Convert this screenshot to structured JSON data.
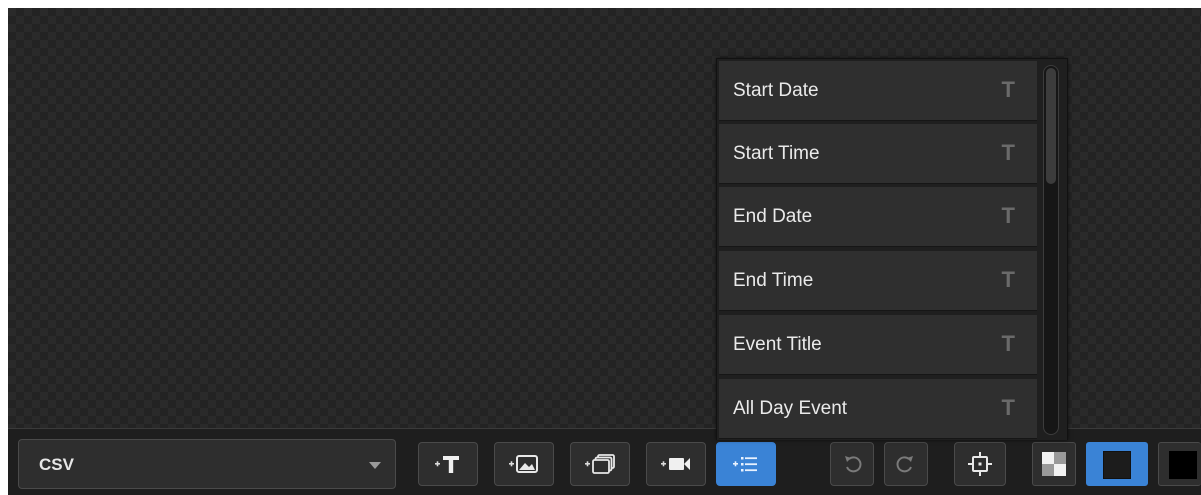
{
  "source": {
    "selected": "CSV"
  },
  "toolbar": {
    "buttons": [
      {
        "name": "add-text-button",
        "icon": "add-text-icon"
      },
      {
        "name": "add-image-button",
        "icon": "add-image-icon"
      },
      {
        "name": "add-slideshow-button",
        "icon": "add-slideshow-icon"
      },
      {
        "name": "add-video-button",
        "icon": "add-video-icon"
      },
      {
        "name": "add-data-field-button",
        "icon": "add-list-icon",
        "active": true
      },
      {
        "name": "undo-button",
        "icon": "undo-icon"
      },
      {
        "name": "redo-button",
        "icon": "redo-icon"
      },
      {
        "name": "fit-to-frame-button",
        "icon": "frame-icon"
      }
    ]
  },
  "fields": [
    {
      "label": "Start Date",
      "type": "T"
    },
    {
      "label": "Start Time",
      "type": "T"
    },
    {
      "label": "End Date",
      "type": "T"
    },
    {
      "label": "End Time",
      "type": "T"
    },
    {
      "label": "Event Title",
      "type": "T"
    },
    {
      "label": "All Day Event",
      "type": "T"
    }
  ],
  "colors": {
    "accent": "#3a83d6",
    "canvas_dark": "#2a2a2a",
    "panel": "#2f2f2f"
  }
}
